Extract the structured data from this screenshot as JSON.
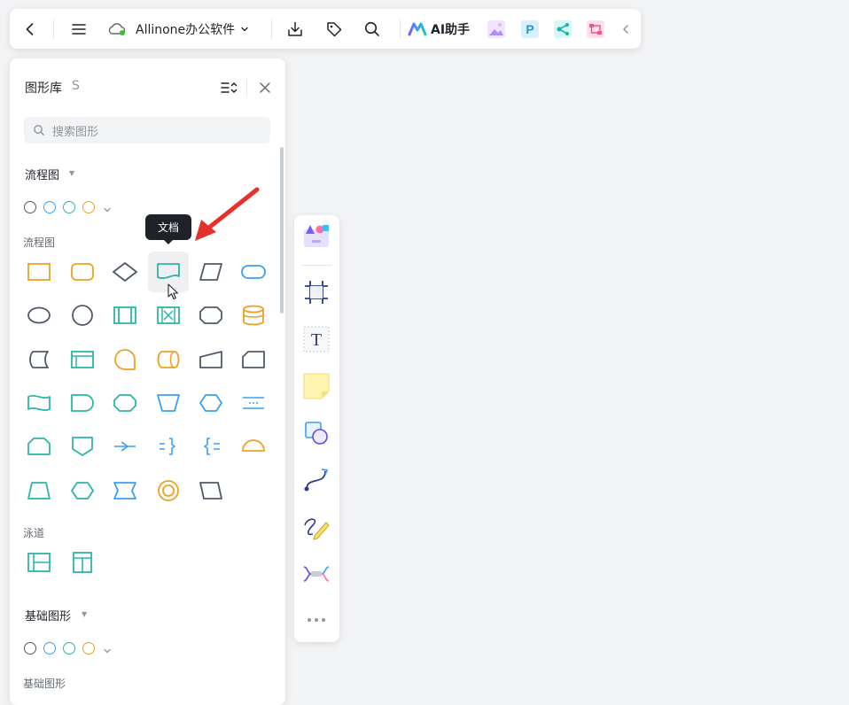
{
  "toolbar": {
    "doc_title": "Allinone办公软件",
    "ai_label": "AI助手",
    "icons": [
      "back-icon",
      "menu-icon",
      "cloud-icon",
      "chevron-down-icon",
      "download-icon",
      "tag-icon",
      "search-icon",
      "ai-logo-icon",
      "image-gen-app-icon",
      "p-app-icon",
      "mindmap-app-icon",
      "flow-app-icon",
      "collapse-icon"
    ]
  },
  "panel": {
    "title": "图形库",
    "shortcut": "S",
    "search_placeholder": "搜索图形",
    "sections": [
      {
        "title": "流程图",
        "sub_label": "流程图"
      },
      {
        "sub_label": "泳道"
      },
      {
        "title": "基础图形",
        "sub_label": "基础图形"
      }
    ],
    "color_sets": [
      "#4e5969",
      "#3b9ef5",
      "#2bb5a8",
      "#f0a020"
    ]
  },
  "tooltip": {
    "text": "文档"
  },
  "colors": {
    "orange": "#f0a020",
    "teal": "#2bb5a8",
    "blue": "#3b9ef5",
    "gray": "#4e5969",
    "annotation_arrow": "#e8302a"
  },
  "toolstrip": {
    "tools": [
      "template-icon",
      "frame-icon",
      "text-icon",
      "sticky-note-icon",
      "shape-icon",
      "connector-icon",
      "pen-icon",
      "mindmap-icon",
      "more-icon"
    ]
  }
}
